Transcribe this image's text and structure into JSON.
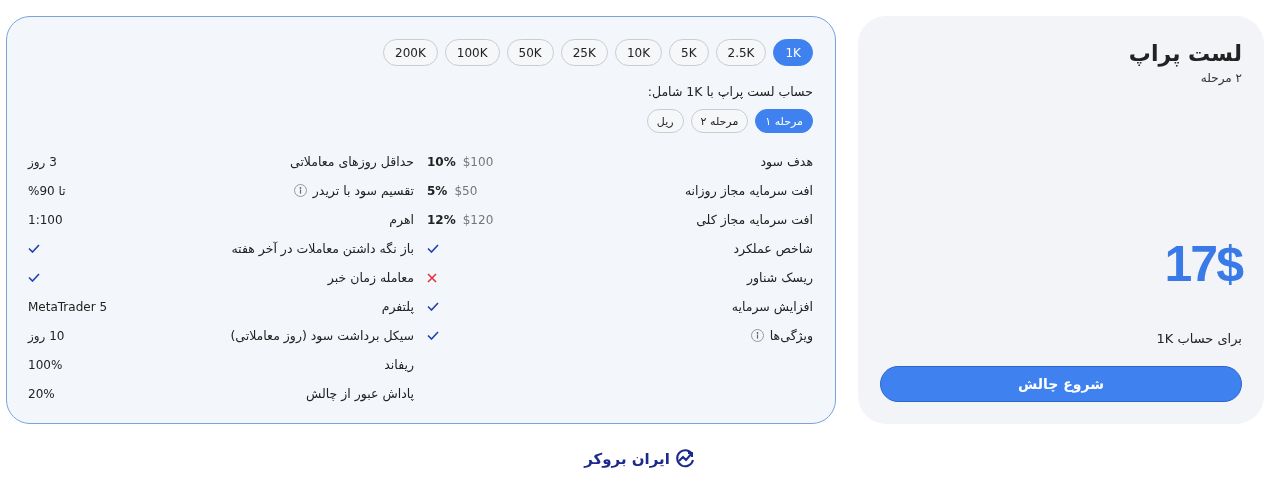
{
  "plan_card": {
    "title": "لست پراپ",
    "subtitle": "۲ مرحله",
    "price": "17$",
    "account_note": "برای حساب 1K",
    "button": "شروع چالش"
  },
  "account_sizes": [
    {
      "label": "1K",
      "selected": true
    },
    {
      "label": "2.5K",
      "selected": false
    },
    {
      "label": "5K",
      "selected": false
    },
    {
      "label": "10K",
      "selected": false
    },
    {
      "label": "25K",
      "selected": false
    },
    {
      "label": "50K",
      "selected": false
    },
    {
      "label": "100K",
      "selected": false
    },
    {
      "label": "200K",
      "selected": false
    }
  ],
  "includes_heading": "حساب لست پراپ با 1K شامل:",
  "stages": [
    {
      "label": "مرحله ۱",
      "selected": true
    },
    {
      "label": "مرحله ۲",
      "selected": false
    },
    {
      "label": "ریل",
      "selected": false
    }
  ],
  "details_right": [
    {
      "label": "هدف سود",
      "kind": "amount",
      "amount": "$100",
      "percent": "10%",
      "info": false
    },
    {
      "label": "افت سرمایه مجاز روزانه",
      "kind": "amount",
      "amount": "$50",
      "percent": "5%",
      "info": false
    },
    {
      "label": "افت سرمایه مجاز کلی",
      "kind": "amount",
      "amount": "$120",
      "percent": "12%",
      "info": false
    },
    {
      "label": "شاخص عملکرد",
      "kind": "yes",
      "info": false
    },
    {
      "label": "ریسک شناور",
      "kind": "no",
      "info": false
    },
    {
      "label": "افزایش سرمایه",
      "kind": "yes",
      "info": false
    },
    {
      "label": "ویژگی‌ها",
      "kind": "yes",
      "info": true
    }
  ],
  "details_left": [
    {
      "label": "حداقل روزهای معاملاتی",
      "kind": "text",
      "value": "3 روز",
      "info": false
    },
    {
      "label": "تقسیم سود با تریدر",
      "kind": "text",
      "value": "تا 90%",
      "info": true
    },
    {
      "label": "اهرم",
      "kind": "text",
      "value": "1:100",
      "info": false
    },
    {
      "label": "باز نگه داشتن معاملات در آخر هفته",
      "kind": "yes",
      "info": false
    },
    {
      "label": "معامله زمان خبر",
      "kind": "yes",
      "info": false
    },
    {
      "label": "پلتفرم",
      "kind": "text",
      "value": "MetaTrader 5",
      "info": false
    },
    {
      "label": "سیکل برداشت سود (روز معاملاتی)",
      "kind": "text",
      "value": "10 روز",
      "info": false
    },
    {
      "label": "ریفاند",
      "kind": "text",
      "value": "100%",
      "info": false
    },
    {
      "label": "پاداش عبور از چالش",
      "kind": "text",
      "value": "20%",
      "info": false
    }
  ],
  "footer_logo": {
    "text": "ایران بروکر"
  }
}
